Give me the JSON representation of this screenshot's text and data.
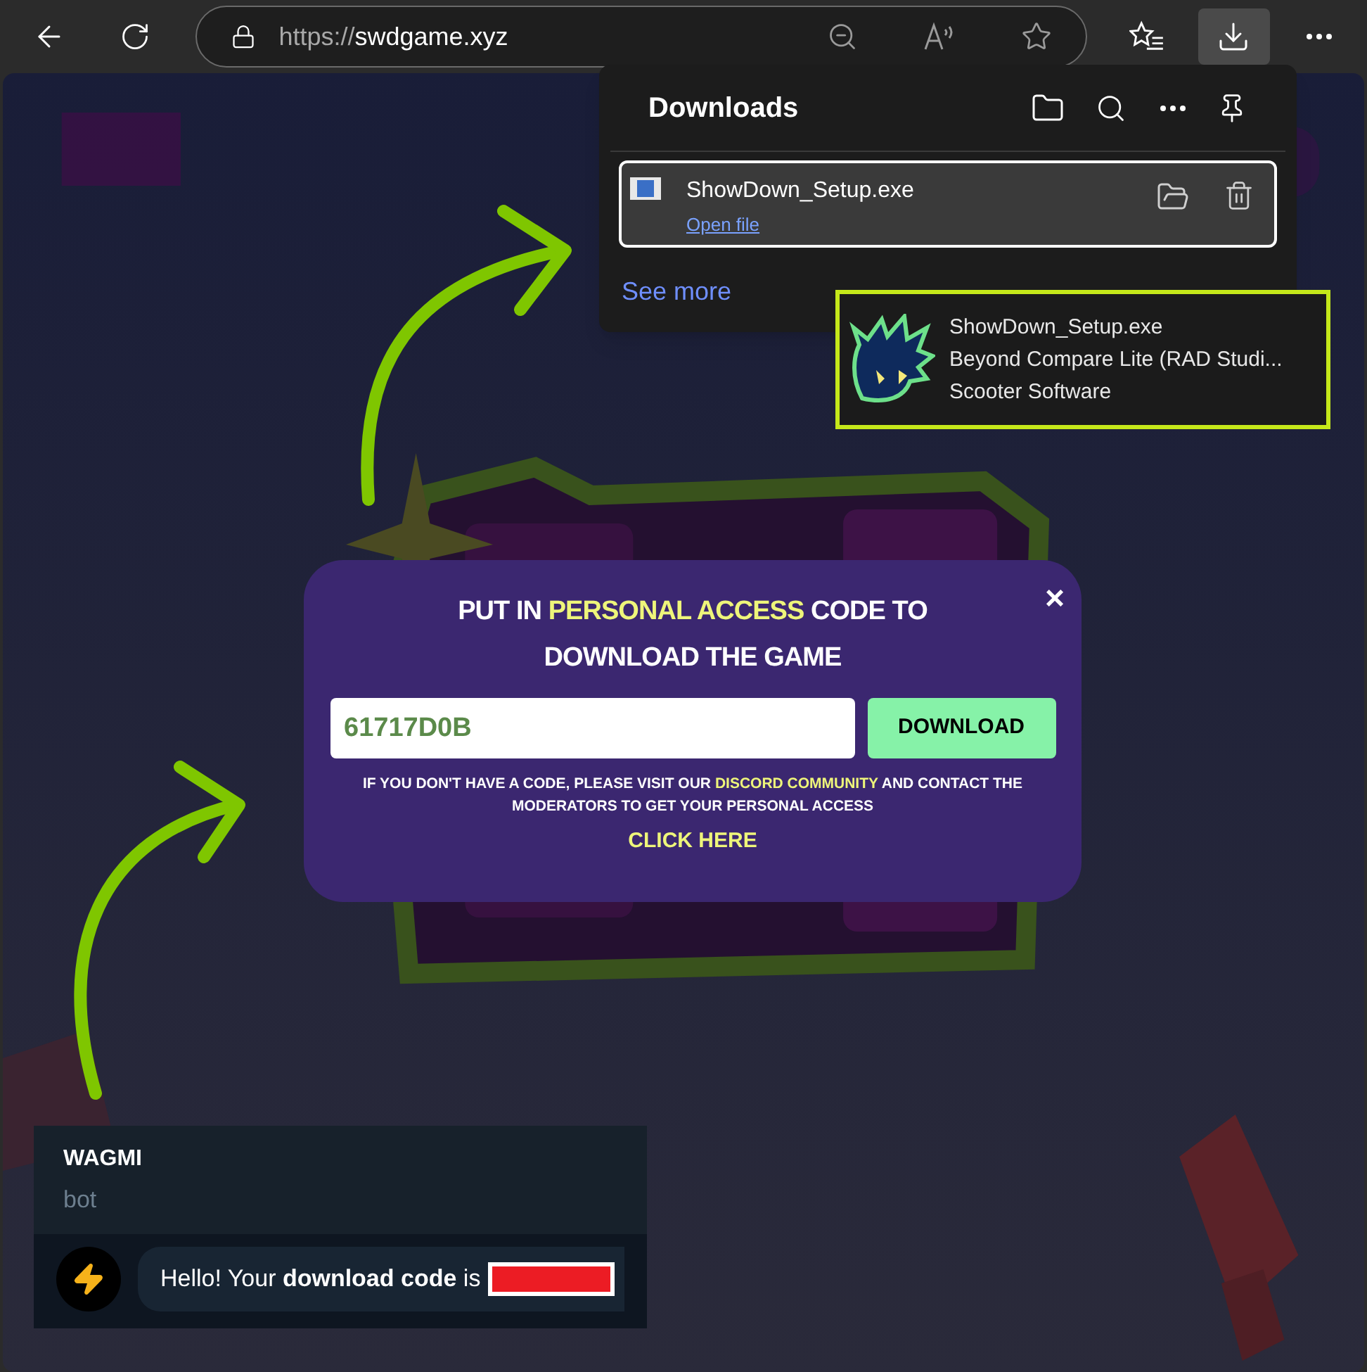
{
  "browser": {
    "url_scheme": "https://",
    "url_host": "swdgame.xyz",
    "downloads_open": true
  },
  "downloads": {
    "title": "Downloads",
    "items": [
      {
        "filename": "ShowDown_Setup.exe",
        "action": "Open file",
        "selected": true
      }
    ],
    "see_more": "See more"
  },
  "tooltip": {
    "filename": "ShowDown_Setup.exe",
    "description": "Beyond Compare Lite (RAD Studi...",
    "publisher": "Scooter Software"
  },
  "modal": {
    "title_parts": [
      {
        "text": "PUT IN ",
        "highlight": false
      },
      {
        "text": "PERSONAL ACCESS",
        "highlight": true
      },
      {
        "text": " CODE TO DOWNLOAD THE GAME",
        "highlight": false
      }
    ],
    "close": "×",
    "code_value": "61717D0B",
    "button": "DOWNLOAD",
    "note_parts": [
      {
        "text": "IF YOU DON'T HAVE A CODE, PLEASE VISIT OUR ",
        "highlight": false
      },
      {
        "text": "DISCORD COMMUNITY",
        "highlight": true
      },
      {
        "text": " AND CONTACT THE MODERATORS TO GET YOUR PERSONAL ACCESS",
        "highlight": false
      }
    ],
    "link": "CLICK HERE"
  },
  "chat": {
    "name": "WAGMI",
    "role": "bot",
    "message": "Hello! Your **download code** is",
    "code_redacted": true
  }
}
